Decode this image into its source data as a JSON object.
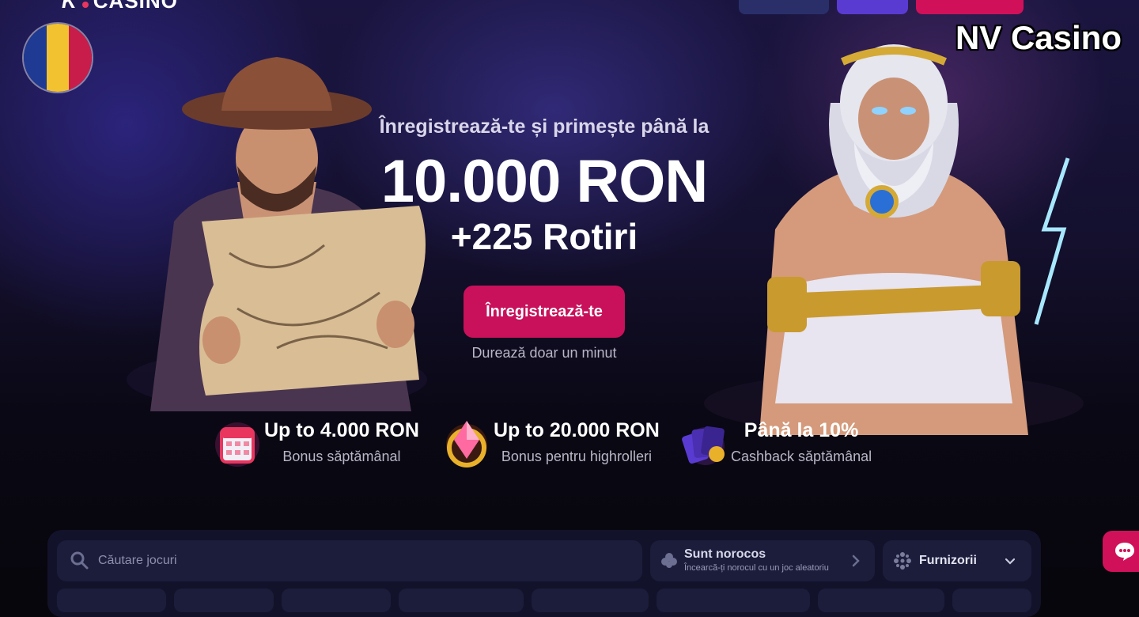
{
  "header": {
    "logo_text": "CASINO"
  },
  "watermark": "NV Casino",
  "hero": {
    "subtitle": "Înregistrează-te și primește până la",
    "amount": "10.000 RON",
    "spins": "+225 Rotiri",
    "cta_label": "Înregistrează-te",
    "cta_note": "Durează doar un minut"
  },
  "perks": [
    {
      "title": "Up to 4.000 RON",
      "subtitle": "Bonus săptămânal",
      "icon": "calendar-icon"
    },
    {
      "title": "Up to 20.000 RON",
      "subtitle": "Bonus pentru highrolleri",
      "icon": "gem-icon"
    },
    {
      "title": "Până la 10%",
      "subtitle": "Cashback săptămânal",
      "icon": "cards-icon"
    }
  ],
  "games": {
    "search_placeholder": "Căutare jocuri",
    "lucky_title": "Sunt norocos",
    "lucky_subtitle": "Încearcă-ți norocul cu un joc aleatoriu",
    "providers_label": "Furnizorii"
  },
  "colors": {
    "accent": "#c8115a",
    "panel": "#12122a",
    "field": "#1c1d3b",
    "flag": [
      "#1f3a93",
      "#f2c230",
      "#c81d4a"
    ]
  }
}
